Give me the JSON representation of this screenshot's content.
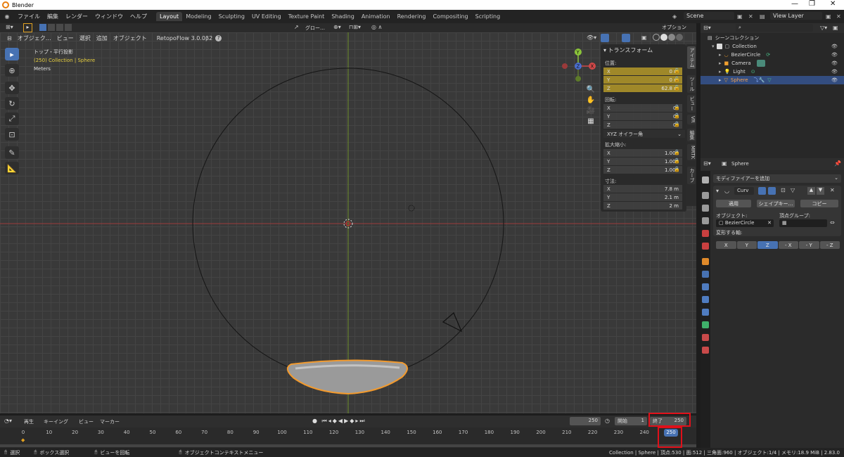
{
  "titlebar": {
    "title": "Blender"
  },
  "menubar": {
    "menus": [
      "ファイル",
      "編集",
      "レンダー",
      "ウィンドウ",
      "ヘルプ"
    ],
    "workspaces": [
      "Layout",
      "Modeling",
      "Sculpting",
      "UV Editing",
      "Texture Paint",
      "Shading",
      "Animation",
      "Rendering",
      "Compositing",
      "Scripting"
    ],
    "scene": "Scene",
    "view_layer": "View Layer"
  },
  "viewport_header": {
    "mode": "オブジェク…",
    "menus": [
      "ビュー",
      "選択",
      "追加",
      "オブジェクト"
    ],
    "addon": "RetopoFlow 3.0.0β2",
    "transform_orientation": "グロー…",
    "options": "オプション"
  },
  "viewport": {
    "view_name": "トップ・平行投影",
    "collection_info": "(250) Collection | Sphere",
    "units": "Meters"
  },
  "gizmo": {
    "x": "X",
    "y": "Y",
    "z": "Z"
  },
  "npanel": {
    "title": "トランスフォーム",
    "location_label": "位置:",
    "location": [
      {
        "axis": "X",
        "value": "0 m"
      },
      {
        "axis": "Y",
        "value": "0 m"
      },
      {
        "axis": "Z",
        "value": "62.8 m"
      }
    ],
    "rotation_label": "回転:",
    "rotation": [
      {
        "axis": "X",
        "value": "0°"
      },
      {
        "axis": "Y",
        "value": "0°"
      },
      {
        "axis": "Z",
        "value": "0°"
      }
    ],
    "rotation_mode": "XYZ オイラー角",
    "scale_label": "拡大縮小:",
    "scale": [
      {
        "axis": "X",
        "value": "1.000"
      },
      {
        "axis": "Y",
        "value": "1.000"
      },
      {
        "axis": "Z",
        "value": "1.000"
      }
    ],
    "dimensions_label": "寸法:",
    "dimensions": [
      {
        "axis": "X",
        "value": "7.8 m"
      },
      {
        "axis": "Y",
        "value": "2.1 m"
      },
      {
        "axis": "Z",
        "value": "2 m"
      }
    ],
    "tabs": [
      "アイテム",
      "ツール",
      "ビュー",
      "VR",
      "編集",
      "MRTK",
      "カーブ"
    ]
  },
  "outliner": {
    "root": "シーンコレクション",
    "collection": "Collection",
    "items": [
      "BezierCircle",
      "Camera",
      "Light",
      "Sphere"
    ]
  },
  "properties": {
    "object_name": "Sphere",
    "add_modifier": "モディファイアーを追加",
    "modifier_name": "Curv",
    "apply": "適用",
    "shapekey": "シェイプキー…",
    "copy": "コピー",
    "object_label": "オブジェクト:",
    "object_value": "BezierCircle",
    "vertex_group_label": "頂点グループ:",
    "deform_axis_label": "変形する軸:",
    "axes": [
      "X",
      "Y",
      "Z",
      "- X",
      "- Y",
      "- Z"
    ]
  },
  "timeline": {
    "menus": [
      "再生",
      "キーイング",
      "ビュー",
      "マーカー"
    ],
    "current_frame": "250",
    "start_label": "開始",
    "start_value": "1",
    "end_label": "終了",
    "end_value": "250",
    "ticks": [
      "0",
      "10",
      "20",
      "30",
      "40",
      "50",
      "60",
      "70",
      "80",
      "90",
      "100",
      "110",
      "120",
      "130",
      "140",
      "150",
      "160",
      "170",
      "180",
      "190",
      "200",
      "210",
      "220",
      "230",
      "240"
    ],
    "playhead": "250"
  },
  "statusbar": {
    "select": "選択",
    "box_select": "ボックス選択",
    "rotate_view": "ビューを回転",
    "context_menu": "オブジェクトコンテキストメニュー",
    "stats": "Collection | Sphere | 頂点:530 | 面:512 | 三角面:960 | オブジェクト:1/4 | メモリ:18.9 MiB | 2.83.0"
  }
}
